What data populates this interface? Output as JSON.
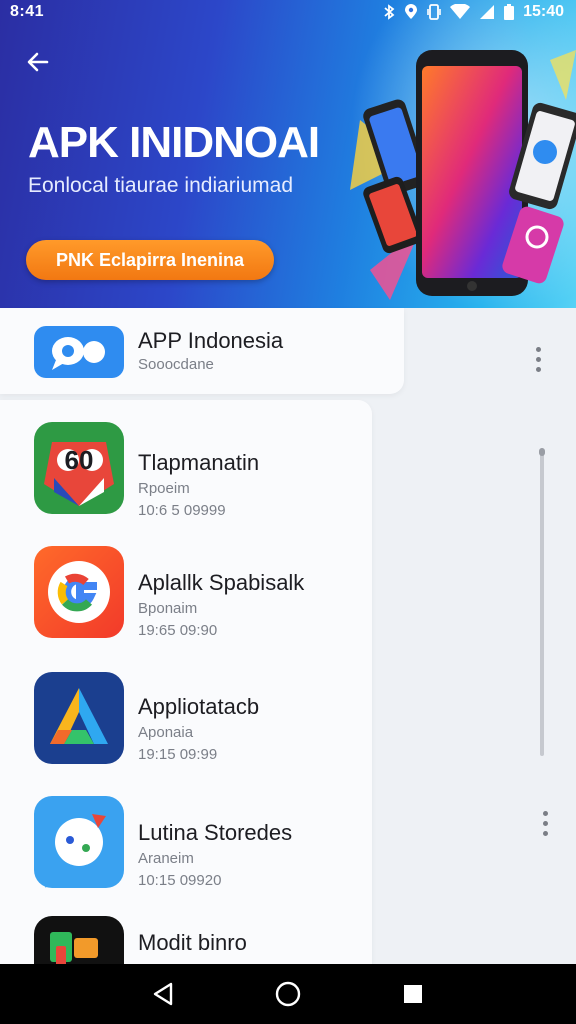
{
  "status_bar": {
    "time": "8:41",
    "clock": "15:40",
    "icons": [
      "bluetooth-icon",
      "location-icon",
      "vibrate-icon",
      "wifi-icon",
      "signal-icon",
      "battery-icon"
    ]
  },
  "header": {
    "back_icon": "arrow-left-icon",
    "title": "APK INIDNOAI",
    "subtitle": "Eonlocal tiaurae indiariumad",
    "cta_label": "PNK Eclapirra Inenina"
  },
  "apps": [
    {
      "name": "APP Indonesia",
      "subtitle": "Sooocdane",
      "date": "",
      "icon": "chat-bubble-icon",
      "accent": "#2f8cf0"
    },
    {
      "name": "Tlapmanatin",
      "subtitle": "Rpoeim",
      "date": "10:6 5 09999",
      "icon": "owl-icon",
      "accent": "#2e9a44"
    },
    {
      "name": "Aplallk Spabisalk",
      "subtitle": "Bponaim",
      "date": "19:65 09:90",
      "icon": "google-g-icon",
      "accent": "#f2572c"
    },
    {
      "name": "Appliotatacb",
      "subtitle": "Aponaia",
      "date": "19:15 09:99",
      "icon": "triangle-logo-icon",
      "accent": "#1b4aa8"
    },
    {
      "name": "Lutina Storedes",
      "subtitle": "Araneim",
      "date": "10:15 09920",
      "icon": "chat-face-icon",
      "accent": "#3aa2f0"
    },
    {
      "name": "Modit binro",
      "subtitle": "",
      "date": "",
      "icon": "puzzle-icon",
      "accent": "#111111"
    }
  ],
  "menu_icon": "more-vertical-icon",
  "nav": {
    "back_icon": "triangle-back-icon",
    "home_icon": "circle-home-icon",
    "recents_icon": "square-recents-icon"
  },
  "colors": {
    "hero_gradient_start": "#2b2ea3",
    "hero_gradient_end": "#56d2f5",
    "cta": "#f27812",
    "list_bg": "#eef1f5"
  }
}
